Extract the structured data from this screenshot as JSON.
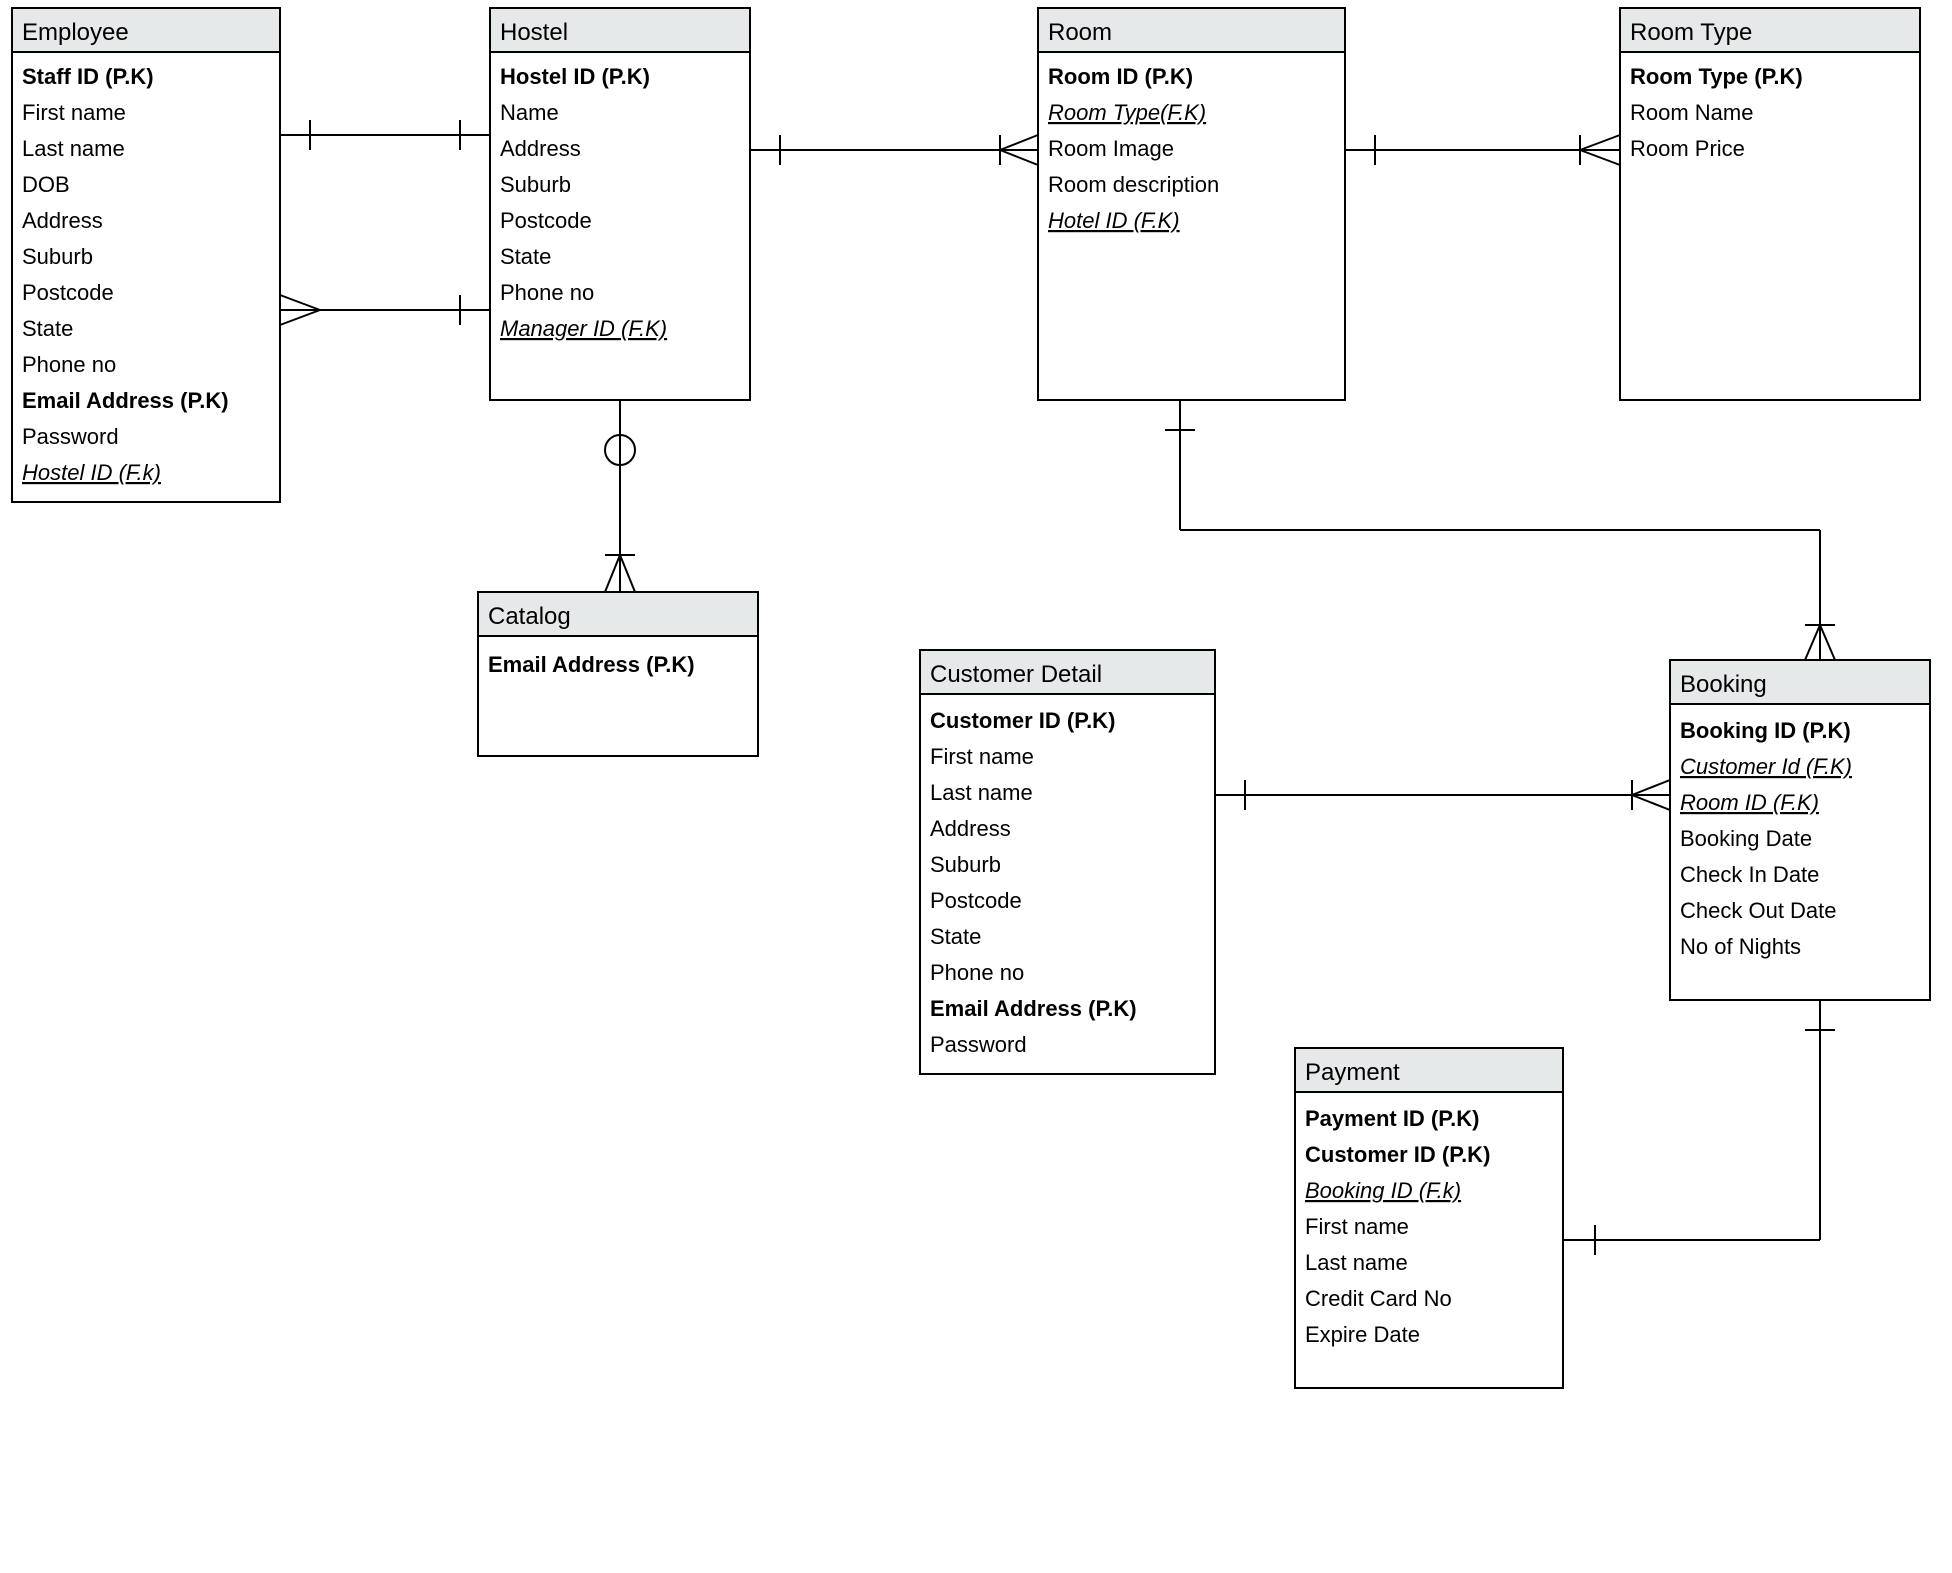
{
  "entities": {
    "employee": {
      "title": "Employee",
      "attrs": [
        {
          "text": "Staff ID (P.K)",
          "bold": true
        },
        {
          "text": "First name"
        },
        {
          "text": "Last name"
        },
        {
          "text": "DOB"
        },
        {
          "text": "Address"
        },
        {
          "text": "Suburb"
        },
        {
          "text": "Postcode"
        },
        {
          "text": "State"
        },
        {
          "text": "Phone no"
        },
        {
          "text": "Email Address (P.K)",
          "bold": true
        },
        {
          "text": "Password"
        },
        {
          "text": "Hostel ID (F.k)",
          "italic": true,
          "underline": true
        }
      ]
    },
    "hostel": {
      "title": "Hostel",
      "attrs": [
        {
          "text": "Hostel ID (P.K)",
          "bold": true
        },
        {
          "text": "Name"
        },
        {
          "text": "Address"
        },
        {
          "text": "Suburb"
        },
        {
          "text": "Postcode"
        },
        {
          "text": "State"
        },
        {
          "text": "Phone no"
        },
        {
          "text": "Manager ID (F.K)",
          "italic": true,
          "underline": true
        }
      ]
    },
    "room": {
      "title": "Room",
      "attrs": [
        {
          "text": "Room ID (P.K)",
          "bold": true
        },
        {
          "text": "Room Type(F.K)",
          "italic": true,
          "underline": true
        },
        {
          "text": "Room Image"
        },
        {
          "text": "Room description"
        },
        {
          "text": "Hotel  ID (F.K)",
          "italic": true,
          "underline": true
        }
      ]
    },
    "roomtype": {
      "title": "Room Type",
      "attrs": [
        {
          "text": "Room Type (P.K)",
          "bold": true
        },
        {
          "text": "Room Name"
        },
        {
          "text": "Room Price"
        }
      ]
    },
    "catalog": {
      "title": "Catalog",
      "attrs": [
        {
          "text": "Email Address (P.K)",
          "bold": true
        }
      ]
    },
    "customer": {
      "title": "Customer Detail",
      "attrs": [
        {
          "text": "Customer ID (P.K)",
          "bold": true
        },
        {
          "text": "First name"
        },
        {
          "text": "Last name"
        },
        {
          "text": "Address"
        },
        {
          "text": "Suburb"
        },
        {
          "text": "Postcode"
        },
        {
          "text": "State"
        },
        {
          "text": "Phone no"
        },
        {
          "text": "Email Address (P.K)",
          "bold": true
        },
        {
          "text": "Password"
        }
      ]
    },
    "booking": {
      "title": "Booking",
      "attrs": [
        {
          "text": "Booking ID (P.K)",
          "bold": true
        },
        {
          "text": "Customer Id (F.K)",
          "italic": true,
          "underline": true
        },
        {
          "text": "Room ID (F.K)",
          "italic": true,
          "underline": true
        },
        {
          "text": "Booking Date"
        },
        {
          "text": "Check In Date"
        },
        {
          "text": "Check Out Date"
        },
        {
          "text": "No of Nights"
        }
      ]
    },
    "payment": {
      "title": "Payment",
      "attrs": [
        {
          "text": "Payment ID (P.K)",
          "bold": true
        },
        {
          "text": "Customer ID (P.K)",
          "bold": true
        },
        {
          "text": "Booking ID (F.k)",
          "italic": true,
          "underline": true
        },
        {
          "text": "First name"
        },
        {
          "text": "Last name"
        },
        {
          "text": "Credit Card No"
        },
        {
          "text": "Expire Date"
        }
      ]
    }
  }
}
